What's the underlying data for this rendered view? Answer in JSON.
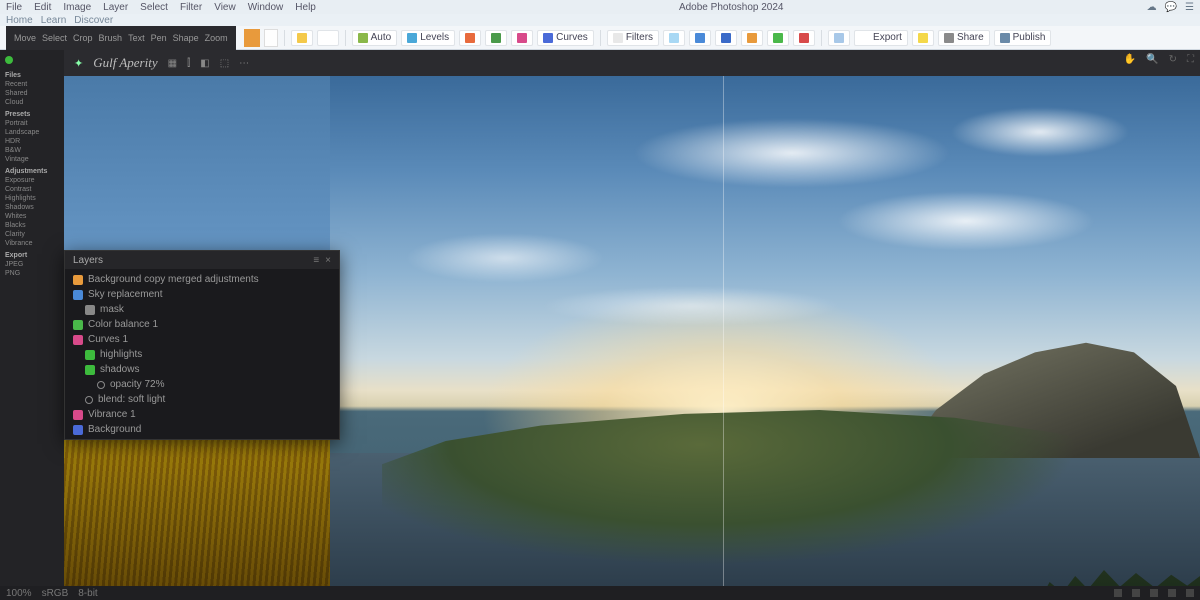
{
  "menubar": {
    "items": [
      "File",
      "Edit",
      "Image",
      "Layer",
      "Select",
      "Filter",
      "View",
      "Window",
      "Help"
    ],
    "center": "Adobe Photoshop 2024",
    "right_icons": [
      "cloud-icon",
      "chat-icon",
      "bell-icon"
    ]
  },
  "topstrip": {
    "items": [
      "Home",
      "Learn",
      "Discover"
    ]
  },
  "ribbon": {
    "dark_items": [
      "Move",
      "Select",
      "Crop",
      "Brush",
      "Text",
      "Pen",
      "Shape",
      "Zoom"
    ],
    "chips": [
      {
        "color": "#f4c94a",
        "label": ""
      },
      {
        "color": "#ffffff",
        "label": ""
      },
      {
        "color": "#8ab84a",
        "label": "Auto"
      },
      {
        "color": "#4aa8d8",
        "label": "Levels"
      },
      {
        "color": "#e86a3c",
        "label": ""
      },
      {
        "color": "#4a9a4a",
        "label": ""
      },
      {
        "color": "#d84a8a",
        "label": ""
      },
      {
        "color": "#4a6ad8",
        "label": "Curves"
      },
      {
        "color": "#e8e8e8",
        "label": "Filters"
      },
      {
        "color": "#a8d8f4",
        "label": ""
      },
      {
        "color": "#4a8ad8",
        "label": ""
      },
      {
        "color": "#3a6ac8",
        "label": ""
      },
      {
        "color": "#e89a3c",
        "label": ""
      },
      {
        "color": "#4ab84a",
        "label": ""
      },
      {
        "color": "#d84a4a",
        "label": ""
      },
      {
        "color": "#a8c8e8",
        "label": ""
      },
      {
        "color": "#ffffff",
        "label": "Export"
      },
      {
        "color": "#f4d84a",
        "label": ""
      },
      {
        "color": "#8a8a8a",
        "label": "Share"
      },
      {
        "color": "#6a8aa8",
        "label": "Publish"
      }
    ]
  },
  "sidebar": {
    "groups": [
      {
        "header": "Files",
        "items": [
          "Recent",
          "Shared",
          "Cloud"
        ]
      },
      {
        "header": "Presets",
        "items": [
          "Portrait",
          "Landscape",
          "HDR",
          "B&W",
          "Vintage"
        ]
      },
      {
        "header": "Adjustments",
        "items": [
          "Exposure",
          "Contrast",
          "Highlights",
          "Shadows",
          "Whites",
          "Blacks",
          "Clarity",
          "Vibrance"
        ]
      },
      {
        "header": "Export",
        "items": [
          "JPEG",
          "PNG"
        ]
      }
    ]
  },
  "main_header": {
    "title": "Gulf Aperity",
    "tool_icons": [
      "grid-icon",
      "histogram-icon",
      "compare-icon",
      "crop-icon",
      "more-icon"
    ],
    "right_icons": [
      "hand-icon",
      "zoom-icon",
      "rotate-icon",
      "fullscreen-icon"
    ]
  },
  "layers_panel": {
    "title": "Layers",
    "rows": [
      {
        "indent": 0,
        "color": "#e89a3c",
        "name": "Background copy merged adjustments"
      },
      {
        "indent": 0,
        "color": "#4a8ad8",
        "name": "Sky replacement"
      },
      {
        "indent": 1,
        "color": "#888888",
        "name": "mask"
      },
      {
        "indent": 0,
        "color": "#4ab84a",
        "name": "Color balance 1"
      },
      {
        "indent": 0,
        "color": "#d84a8a",
        "name": "Curves 1"
      },
      {
        "indent": 1,
        "color": "#3dbb3d",
        "name": "highlights"
      },
      {
        "indent": 1,
        "color": "#3dbb3d",
        "name": "shadows"
      },
      {
        "indent": 2,
        "color": "#00000000",
        "name": "opacity 72%",
        "ring": true
      },
      {
        "indent": 1,
        "color": "#00000000",
        "name": "blend: soft light",
        "ring": true
      },
      {
        "indent": 0,
        "color": "#d84a8a",
        "name": "Vibrance 1"
      },
      {
        "indent": 0,
        "color": "#4a6ad8",
        "name": "Background"
      }
    ]
  },
  "statusbar": {
    "left": [
      "100%",
      "sRGB",
      "8-bit"
    ],
    "right_icons": [
      "layers-icon",
      "channels-icon",
      "paths-icon",
      "history-icon",
      "info-icon"
    ]
  }
}
